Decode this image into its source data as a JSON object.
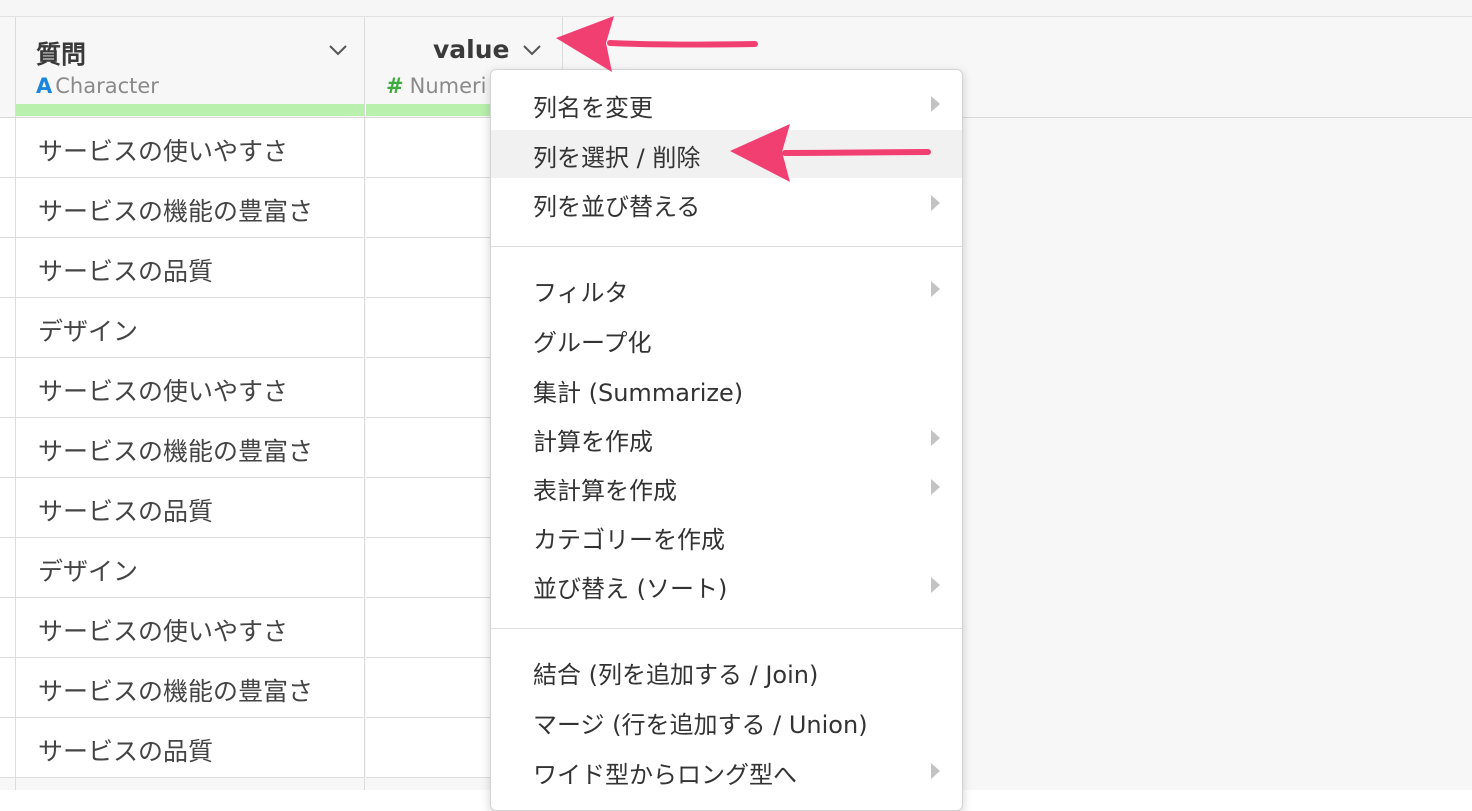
{
  "columns": [
    {
      "name": "質問",
      "type_label": "Character",
      "type_mark": "A"
    },
    {
      "name": "value",
      "type_label": "Numeri",
      "type_mark": "#"
    }
  ],
  "rows": [
    "サービスの使いやすさ",
    "サービスの機能の豊富さ",
    "サービスの品質",
    "デザイン",
    "サービスの使いやすさ",
    "サービスの機能の豊富さ",
    "サービスの品質",
    "デザイン",
    "サービスの使いやすさ",
    "サービスの機能の豊富さ",
    "サービスの品質"
  ],
  "menu": {
    "group1": [
      {
        "label": "列名を変更",
        "submenu": true
      },
      {
        "label": "列を選択 / 削除",
        "submenu": false,
        "highlighted": true
      },
      {
        "label": "列を並び替える",
        "submenu": true
      }
    ],
    "group2": [
      {
        "label": "フィルタ",
        "submenu": true
      },
      {
        "label": "グループ化",
        "submenu": false
      },
      {
        "label": "集計 (Summarize)",
        "submenu": false
      },
      {
        "label": "計算を作成",
        "submenu": true
      },
      {
        "label": "表計算を作成",
        "submenu": true
      },
      {
        "label": "カテゴリーを作成",
        "submenu": false
      },
      {
        "label": "並び替え (ソート)",
        "submenu": true
      }
    ],
    "group3": [
      {
        "label": "結合 (列を追加する / Join)",
        "submenu": false
      },
      {
        "label": "マージ (行を追加する / Union)",
        "submenu": false
      },
      {
        "label": "ワイド型からロング型へ",
        "submenu": true
      }
    ]
  },
  "icons": {
    "column_menu": "chevron-down-icon",
    "submenu": "chevron-right-icon",
    "annotation": "arrow-icon"
  },
  "colors": {
    "annotation_arrow": "#f23f72",
    "character_type": "#1b86dd",
    "numeric_type": "#3eab3e",
    "column_quality_bar": "#b9f0ad",
    "menu_highlight": "#f1f1f1"
  }
}
